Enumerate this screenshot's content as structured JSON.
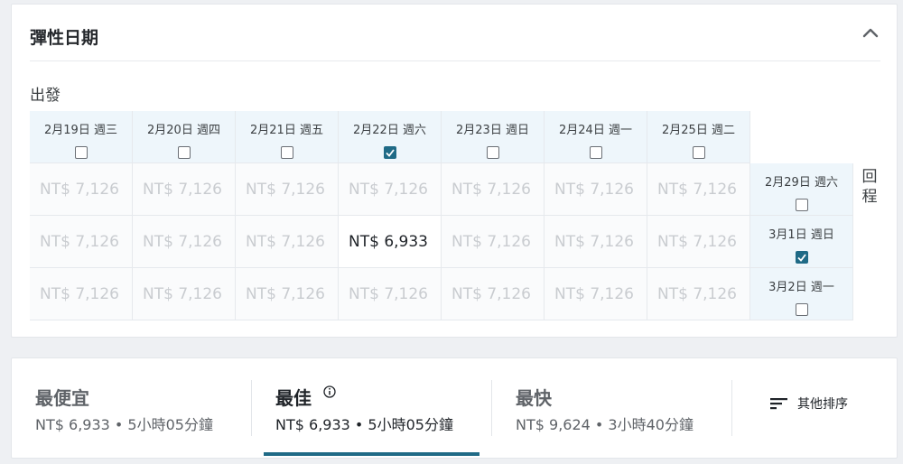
{
  "flex": {
    "title": "彈性日期",
    "depart_label": "出發",
    "return_label": "回程",
    "departure_dates": [
      {
        "label": "2月19日 週三",
        "checked": false
      },
      {
        "label": "2月20日 週四",
        "checked": false
      },
      {
        "label": "2月21日 週五",
        "checked": false
      },
      {
        "label": "2月22日 週六",
        "checked": true
      },
      {
        "label": "2月23日 週日",
        "checked": false
      },
      {
        "label": "2月24日 週一",
        "checked": false
      },
      {
        "label": "2月25日 週二",
        "checked": false
      }
    ],
    "return_dates": [
      {
        "label": "2月29日 週六",
        "checked": false
      },
      {
        "label": "3月1日 週日",
        "checked": true
      },
      {
        "label": "3月2日 週一",
        "checked": false
      }
    ],
    "prices": [
      [
        "NT$ 7,126",
        "NT$ 7,126",
        "NT$ 7,126",
        "NT$ 7,126",
        "NT$ 7,126",
        "NT$ 7,126",
        "NT$ 7,126"
      ],
      [
        "NT$ 7,126",
        "NT$ 7,126",
        "NT$ 7,126",
        "NT$ 6,933",
        "NT$ 7,126",
        "NT$ 7,126",
        "NT$ 7,126"
      ],
      [
        "NT$ 7,126",
        "NT$ 7,126",
        "NT$ 7,126",
        "NT$ 7,126",
        "NT$ 7,126",
        "NT$ 7,126",
        "NT$ 7,126"
      ]
    ],
    "highlight": {
      "row": 1,
      "col": 3
    }
  },
  "sort": {
    "tabs": [
      {
        "title": "最便宜",
        "sub": "NT$ 6,933 • 5小時05分鐘",
        "active": false
      },
      {
        "title": "最佳",
        "sub": "NT$ 6,933 • 5小時05分鐘",
        "active": true
      },
      {
        "title": "最快",
        "sub": "NT$ 9,624 • 3小時40分鐘",
        "active": false
      }
    ],
    "more_label": "其他排序"
  },
  "colors": {
    "accent": "#1f6a86",
    "header_bg": "#eef6fb"
  },
  "icons": {
    "collapse": "chevron-up-icon",
    "info": "info-icon",
    "sort": "sort-lines-icon",
    "check": "check-icon"
  }
}
